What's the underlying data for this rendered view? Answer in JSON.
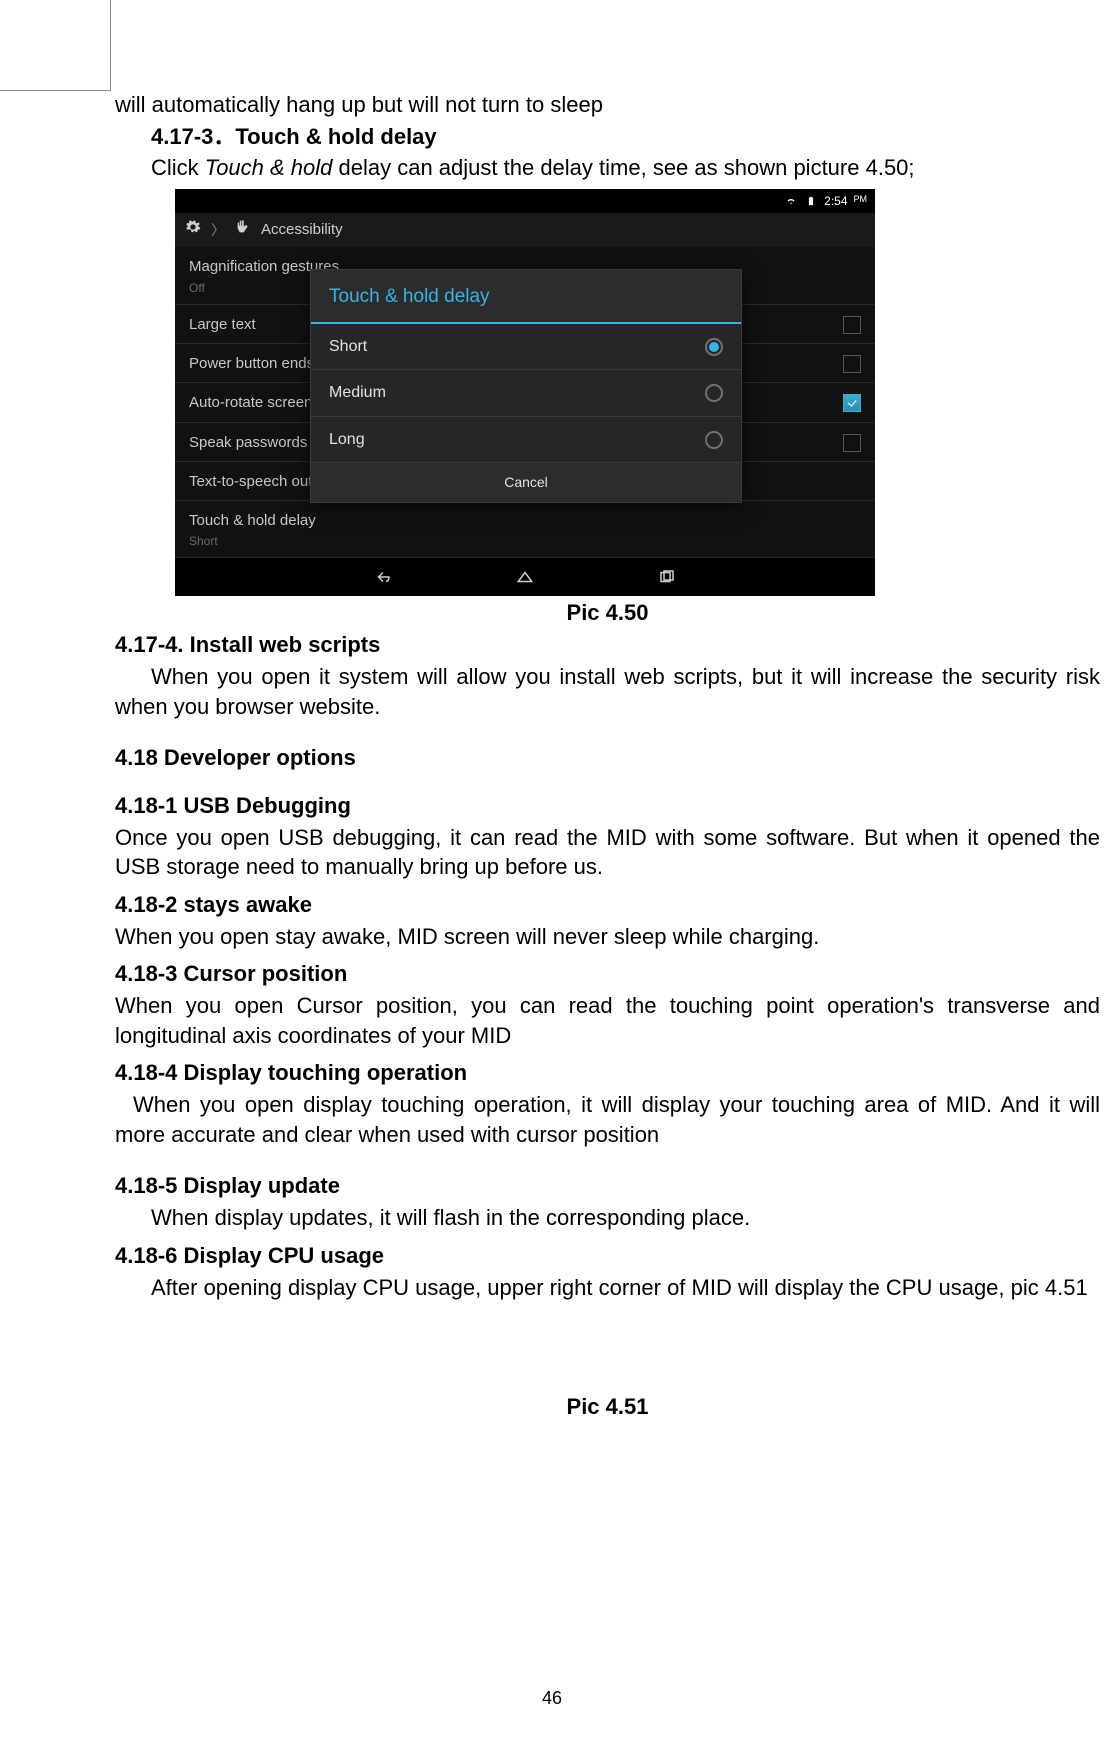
{
  "page_number": "46",
  "text": {
    "line_pre": "will automatically hang up but will not turn to sleep",
    "h_4_17_3": "4.17-3．Touch & hold delay",
    "p_4_17_3_a": "Click ",
    "p_4_17_3_italic": "Touch & hold",
    "p_4_17_3_b": " delay can adjust the delay time, see as shown picture 4.50;",
    "caption_450": "Pic 4.50",
    "h_4_17_4": "4.17-4. Install web scripts",
    "p_4_17_4": "When you open it system will allow you install web scripts, but it will increase the security risk when you browser website.",
    "h_4_18": "4.18 Developer options",
    "h_4_18_1": "4.18-1 USB Debugging",
    "p_4_18_1": "Once you open USB debugging, it can read the MID with some software. But when it opened the USB storage need to manually bring up before us.",
    "h_4_18_2": "4.18-2 stays awake",
    "p_4_18_2": "When you open stay awake, MID screen will never sleep while charging.",
    "h_4_18_3_prefix": "4.18-3",
    "h_4_18_3_rest": " Cursor position",
    "p_4_18_3": "When you open Cursor position, you can read the touching point operation's transverse and longitudinal axis coordinates of your MID",
    "h_4_18_4": "4.18-4 Display touching operation",
    "p_4_18_4": "When you open display touching operation, it will display your touching area of MID. And it will more accurate and clear when used with cursor position",
    "h_4_18_5": "4.18-5 Display update",
    "p_4_18_5": "When display updates, it will flash in the corresponding place.",
    "h_4_18_6": "4.18-6 Display CPU usage",
    "p_4_18_6": "After opening display CPU usage, upper right corner of MID will display the CPU usage, pic 4.51",
    "caption_451": "Pic 4.51"
  },
  "screenshot": {
    "status_time": "2:54",
    "status_ampm": "PM",
    "breadcrumb_app": "Accessibility",
    "dialog_title": "Touch & hold delay",
    "options": [
      "Short",
      "Medium",
      "Long"
    ],
    "selected_index": 0,
    "cancel": "Cancel",
    "items": [
      {
        "title": "Magnification gestures",
        "sub": "Off",
        "control": "none"
      },
      {
        "title": "Large text",
        "sub": "",
        "control": "checkbox",
        "checked": false
      },
      {
        "title": "Power button ends call",
        "sub": "",
        "control": "checkbox",
        "checked": false
      },
      {
        "title": "Auto-rotate screen",
        "sub": "",
        "control": "checkbox",
        "checked": true
      },
      {
        "title": "Speak passwords",
        "sub": "",
        "control": "checkbox",
        "checked": false
      },
      {
        "title": "Text-to-speech output",
        "sub": "",
        "control": "none"
      },
      {
        "title": "Touch & hold delay",
        "sub": "Short",
        "control": "none"
      }
    ]
  }
}
